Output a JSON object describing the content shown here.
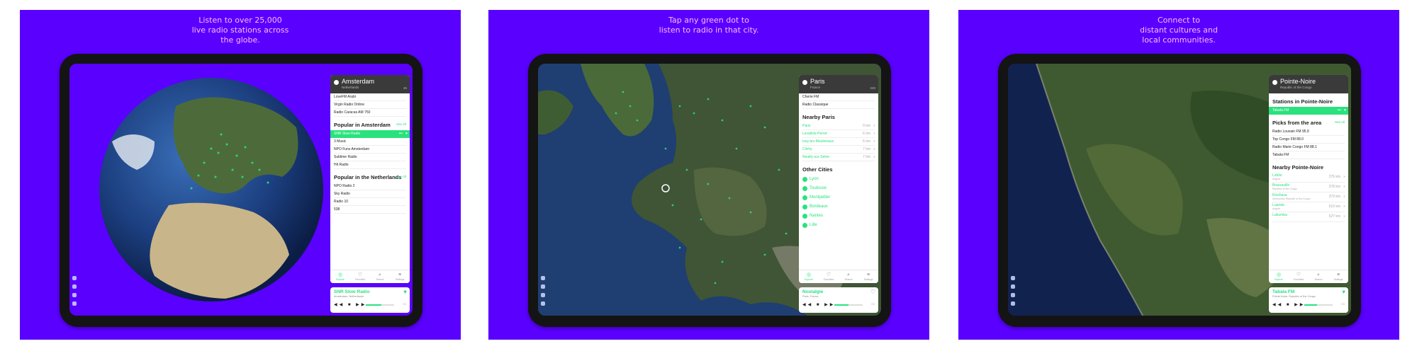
{
  "panels": [
    {
      "caption": [
        "Listen to over 25,000",
        "live radio stations across",
        "the globe."
      ],
      "map": "globe",
      "sidebar": {
        "city": "Amsterdam",
        "subtitle": "Netherlands",
        "count": "45",
        "top_stations": [
          "LoveFM Arabi",
          "Virgin Radio Online",
          "Radio Caracas AM 750"
        ],
        "sections": [
          {
            "title": "Popular in Amsterdam",
            "see_all": "See All",
            "highlight": "SNR Slow Radio",
            "stations": [
              "3 Music",
              "NPO Funx Amsterdam",
              "Sublime Radio",
              "Hit Radio"
            ]
          },
          {
            "title": "Popular in the Netherlands",
            "see_all": "See All",
            "stations": [
              "NPO Radio 2",
              "Sky Radio",
              "Radio 10",
              "538"
            ]
          }
        ]
      },
      "player": {
        "name": "SNR Slow Radio",
        "subtitle": "Amsterdam, Netherlands",
        "progress": 0.55
      }
    },
    {
      "caption": [
        "Tap any green dot to",
        "listen to radio in that city."
      ],
      "map": "france",
      "sidebar": {
        "city": "Paris",
        "subtitle": "France",
        "count": "220",
        "top_stations": [
          "Cherie FM",
          "Radio Classique"
        ],
        "nearby_title": "Nearby Paris",
        "nearby": [
          {
            "name": "Paris",
            "dist": "0 km"
          },
          {
            "name": "Levallois-Perret",
            "dist": "6 km"
          },
          {
            "name": "Issy-les-Moulineaux",
            "dist": "6 km"
          },
          {
            "name": "Clichy",
            "dist": "7 km"
          },
          {
            "name": "Neuilly-sur-Seine",
            "dist": "7 km"
          }
        ],
        "other_title": "Other Cities",
        "other": [
          "Lyon",
          "Toulouse",
          "Montpellier",
          "Bordeaux",
          "Nantes",
          "Lille"
        ]
      },
      "player": {
        "name": "Nostalgie",
        "subtitle": "Paris, France",
        "progress": 0.5
      }
    },
    {
      "caption": [
        "Connect to",
        "distant cultures and",
        "local communities."
      ],
      "map": "congo",
      "sidebar": {
        "city": "Pointe-Noire",
        "subtitle": "Republic of the Congo",
        "count": "",
        "stations_title": "Stations in Pointe-Noire",
        "highlight": "Tabala FM",
        "picks_title": "Picks from the area",
        "see_all": "See All",
        "picks": [
          "Radio Louvain FM 95.9",
          "Top Congo FM 88.0",
          "Radio Marie Congo FM 88.1",
          "Tabala FM"
        ],
        "nearby_title": "Nearby Pointe-Noire",
        "nearby": [
          {
            "name": "Lobito",
            "sub": "Angola",
            "dist": "276 km"
          },
          {
            "name": "Brazzaville",
            "sub": "Republic of the Congo",
            "dist": "378 km"
          },
          {
            "name": "Kinshasa",
            "sub": "Democratic Republic of the Congo",
            "dist": "379 km"
          },
          {
            "name": "Luanda",
            "sub": "Angola",
            "dist": "510 km"
          },
          {
            "name": "Lubumba",
            "sub": "",
            "dist": "527 km"
          }
        ]
      },
      "player": {
        "name": "Tabala FM",
        "subtitle": "Pointe-Noire, Republic of the Congo",
        "progress": 0.45
      }
    }
  ],
  "tabs": [
    "Explore",
    "Favorites",
    "Search",
    "Settings"
  ],
  "icons": {
    "explore": "compass-icon",
    "favorites": "heart-icon",
    "search": "search-icon",
    "settings": "sliders-icon",
    "play": "play-icon",
    "heart": "heart-icon"
  },
  "colors": {
    "background": "#5a00ff",
    "accent": "#29e27d",
    "caption": "#ffb8ff"
  }
}
